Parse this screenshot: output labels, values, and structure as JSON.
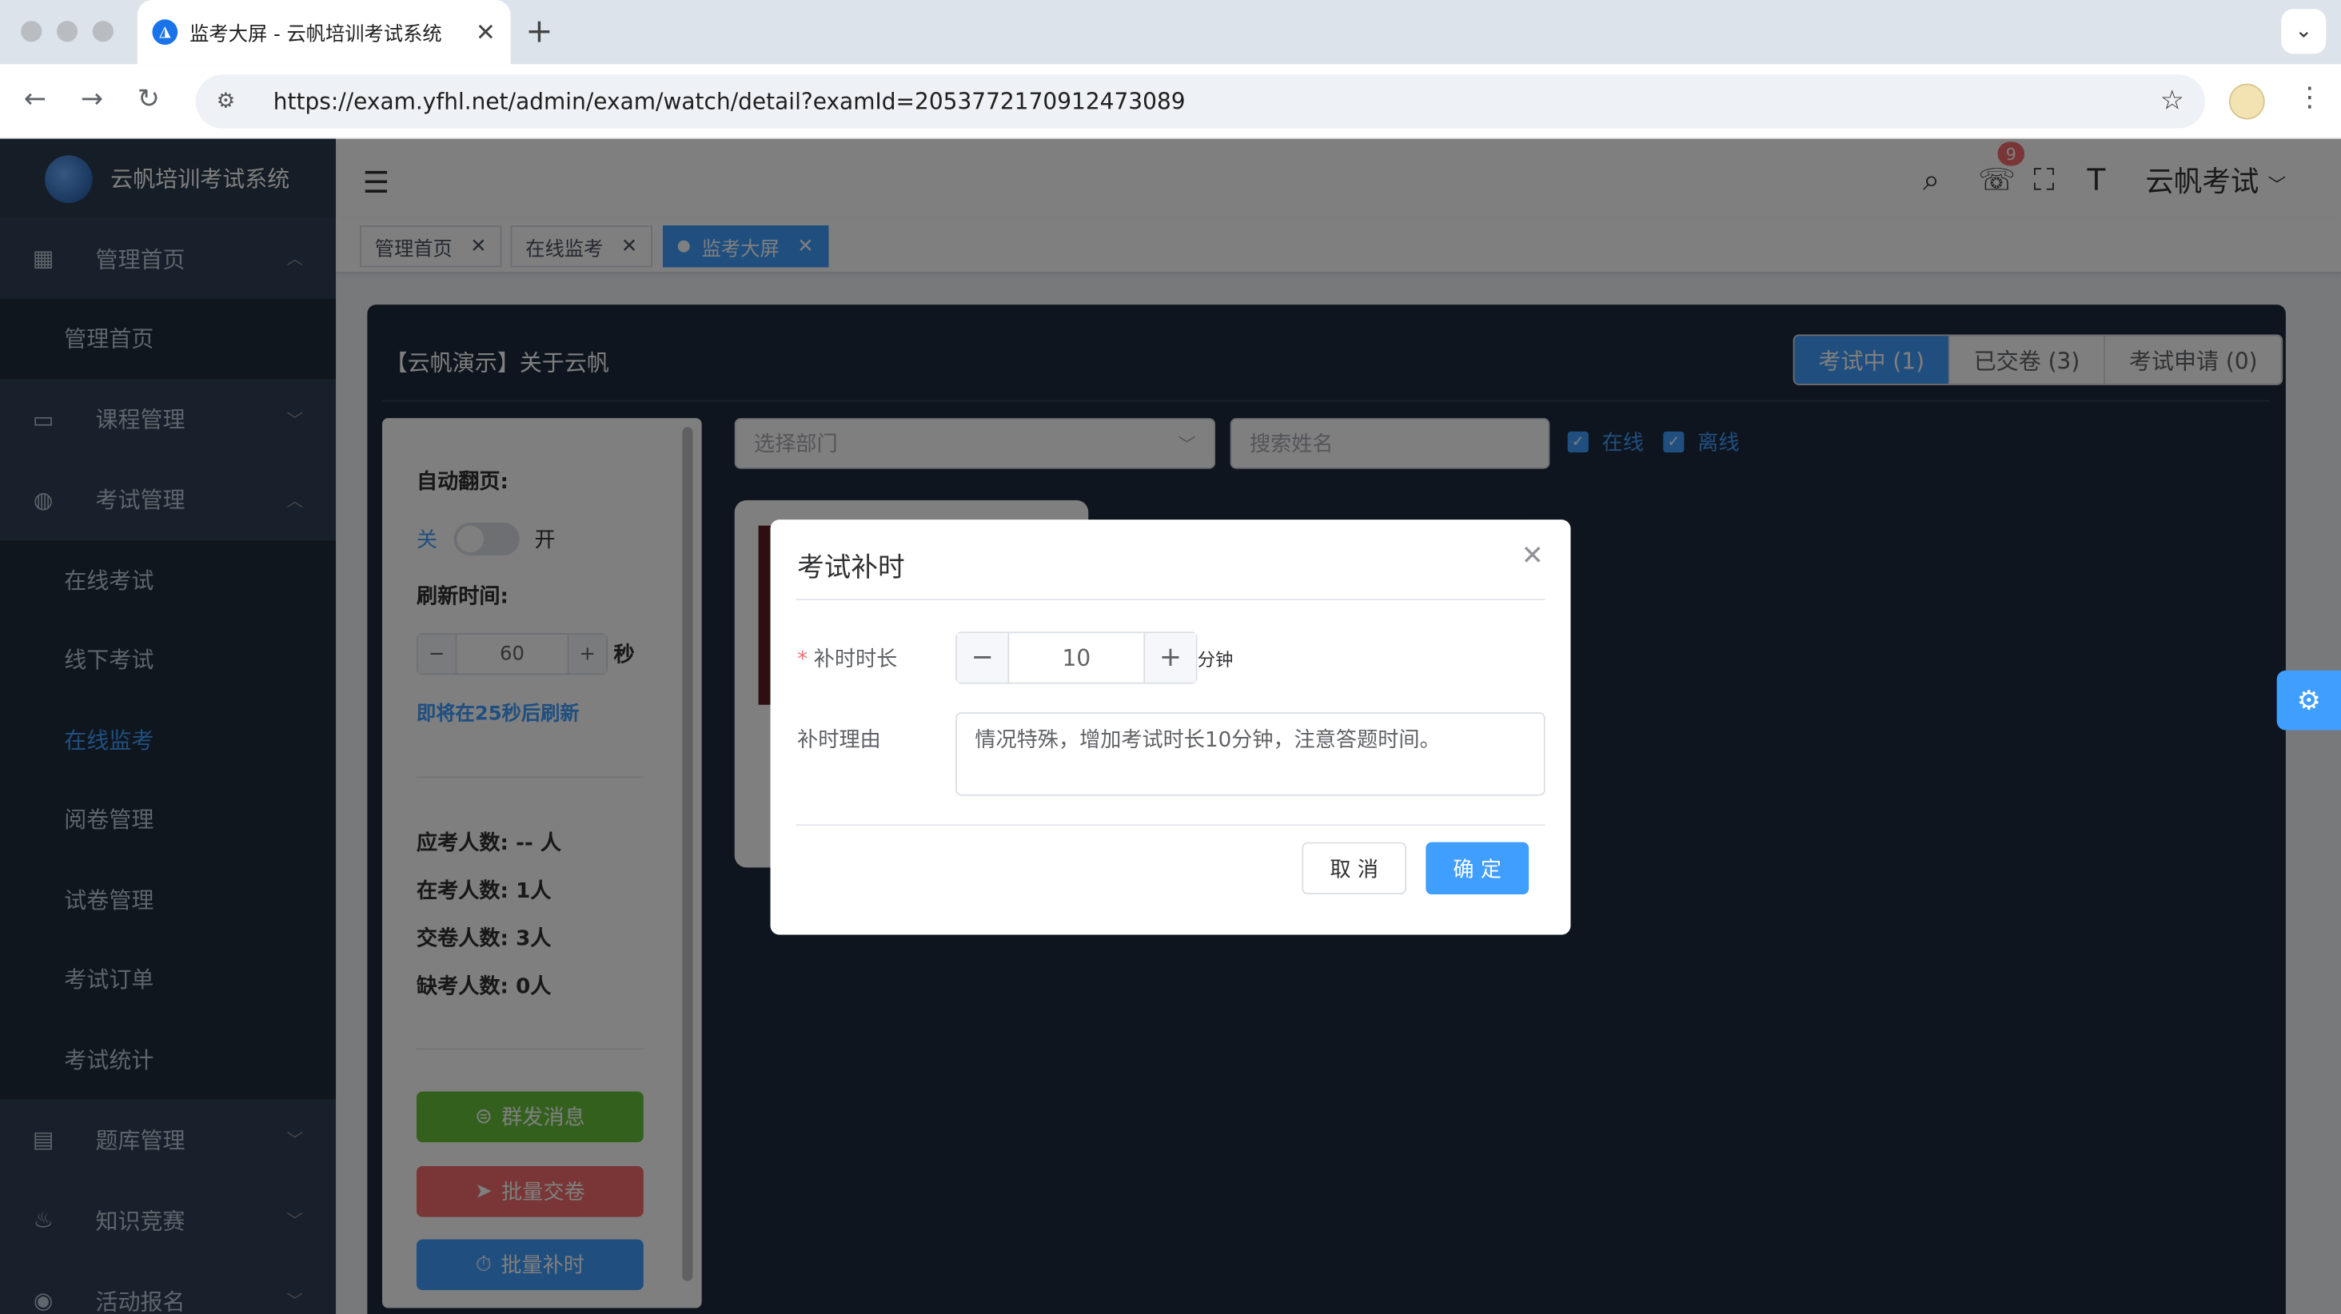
{
  "browser": {
    "tab_title": "监考大屏 - 云帆培训考试系统",
    "url": "https://exam.yfhl.net/admin/exam/watch/detail?examId=2053772170912473089"
  },
  "sidebar": {
    "brand": "云帆培训考试系统",
    "items": [
      {
        "label": "管理首页"
      },
      {
        "label": "管理首页"
      },
      {
        "label": "课程管理"
      },
      {
        "label": "考试管理"
      },
      {
        "label": "在线考试"
      },
      {
        "label": "线下考试"
      },
      {
        "label": "在线监考"
      },
      {
        "label": "阅卷管理"
      },
      {
        "label": "试卷管理"
      },
      {
        "label": "考试订单"
      },
      {
        "label": "考试统计"
      },
      {
        "label": "题库管理"
      },
      {
        "label": "知识竞赛"
      },
      {
        "label": "活动报名"
      }
    ]
  },
  "header": {
    "notify_count": "9",
    "user_name": "云帆考试"
  },
  "tags": [
    {
      "label": "管理首页"
    },
    {
      "label": "在线监考"
    },
    {
      "label": "监考大屏"
    }
  ],
  "panel": {
    "title": "【云帆演示】关于云帆",
    "tabs": [
      {
        "label": "考试中 (1)"
      },
      {
        "label": "已交卷 (3)"
      },
      {
        "label": "考试申请 (0)"
      }
    ],
    "dept_placeholder": "选择部门",
    "name_placeholder": "搜索姓名",
    "online_label": "在线",
    "offline_label": "离线"
  },
  "controls": {
    "auto_page_label": "自动翻页:",
    "off_label": "关",
    "on_label": "开",
    "refresh_label": "刷新时间:",
    "refresh_value": "60",
    "refresh_unit": "秒",
    "refresh_hint": "即将在25秒后刷新",
    "stats": [
      {
        "text": "应考人数: -- 人"
      },
      {
        "text": "在考人数: 1人"
      },
      {
        "text": "交卷人数: 3人"
      },
      {
        "text": "缺考人数: 0人"
      }
    ],
    "btn_message": "群发消息",
    "btn_submit": "批量交卷",
    "btn_extend": "批量补时"
  },
  "dialog": {
    "title": "考试补时",
    "duration_label": "补时时长",
    "duration_value": "10",
    "duration_unit": "分钟",
    "reason_label": "补时理由",
    "reason_value": "情况特殊，增加考试时长10分钟，注意答题时间。",
    "cancel": "取 消",
    "confirm": "确 定"
  },
  "colors": {
    "primary": "#409eff",
    "success": "#67c23a",
    "danger": "#f56c6c",
    "sidebar": "#304156"
  }
}
